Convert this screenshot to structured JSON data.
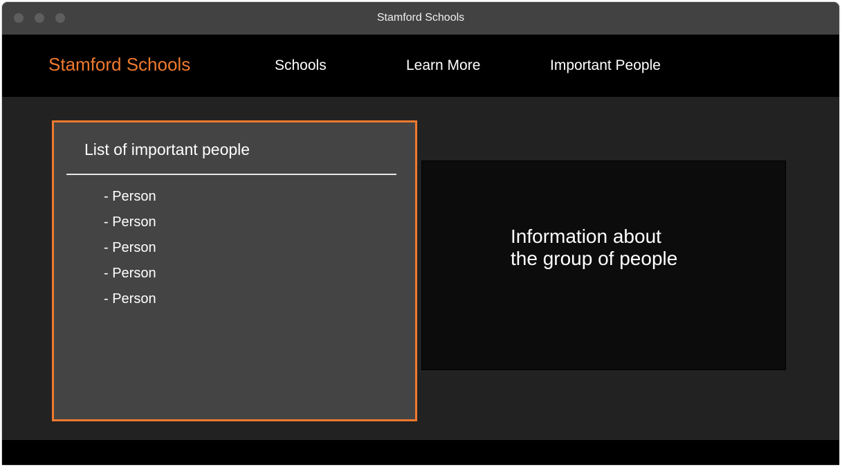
{
  "window": {
    "title": "Stamford Schools"
  },
  "navbar": {
    "brand": "Stamford Schools",
    "items": [
      {
        "label": "Schools"
      },
      {
        "label": "Learn More"
      },
      {
        "label": "Important People"
      }
    ]
  },
  "people_list": {
    "title": "List of important people",
    "items": [
      {
        "label": "- Person"
      },
      {
        "label": "- Person"
      },
      {
        "label": "- Person"
      },
      {
        "label": "- Person"
      },
      {
        "label": "- Person"
      }
    ]
  },
  "info_panel": {
    "line1": "Information about",
    "line2": "the group of people"
  },
  "colors": {
    "accent": "#f07a2e",
    "navbar_bg": "#000000",
    "content_bg": "#222222",
    "list_panel_bg": "#444444",
    "info_panel_bg": "#0c0c0c"
  }
}
